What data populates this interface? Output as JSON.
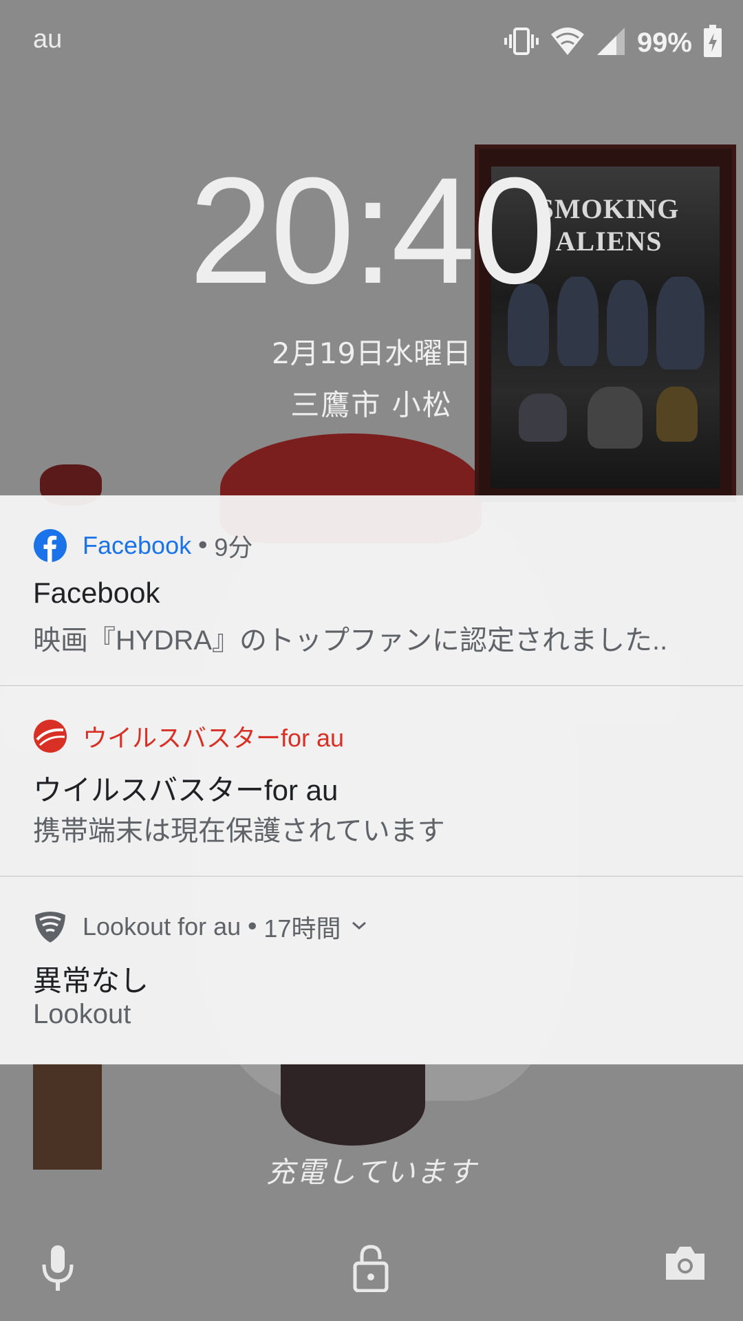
{
  "status_bar": {
    "carrier": "au",
    "battery_percent": "99%",
    "icons": [
      "vibrate-icon",
      "wifi-icon",
      "cell-signal-icon",
      "battery-charging-icon"
    ]
  },
  "lockscreen": {
    "clock": "20:40",
    "date": "2月19日水曜日",
    "location": "三鷹市  小松",
    "charging_text": "充電しています"
  },
  "notifications": [
    {
      "app_name": "Facebook",
      "separator": "•",
      "time": "9分",
      "title": "Facebook",
      "text": "映画『HYDRA』のトップファンに認定されました..",
      "app_color": "#1a73e8",
      "icon": "facebook-icon"
    },
    {
      "app_name": "ウイルスバスターfor au",
      "separator": "",
      "time": "",
      "title": "ウイルスバスターfor au",
      "text": "携帯端末は現在保護されています",
      "app_color": "#d93025",
      "icon": "virusbuster-icon"
    },
    {
      "app_name": "Lookout for au",
      "separator": "•",
      "time": "17時間",
      "title": "異常なし",
      "text": "Lookout",
      "app_color": "#5f6368",
      "icon": "lookout-shield-icon"
    }
  ],
  "bottom_icons": [
    "microphone-icon",
    "lock-icon",
    "camera-icon"
  ],
  "wallpaper": {
    "poster_text": "SMOKING ALIENS"
  }
}
